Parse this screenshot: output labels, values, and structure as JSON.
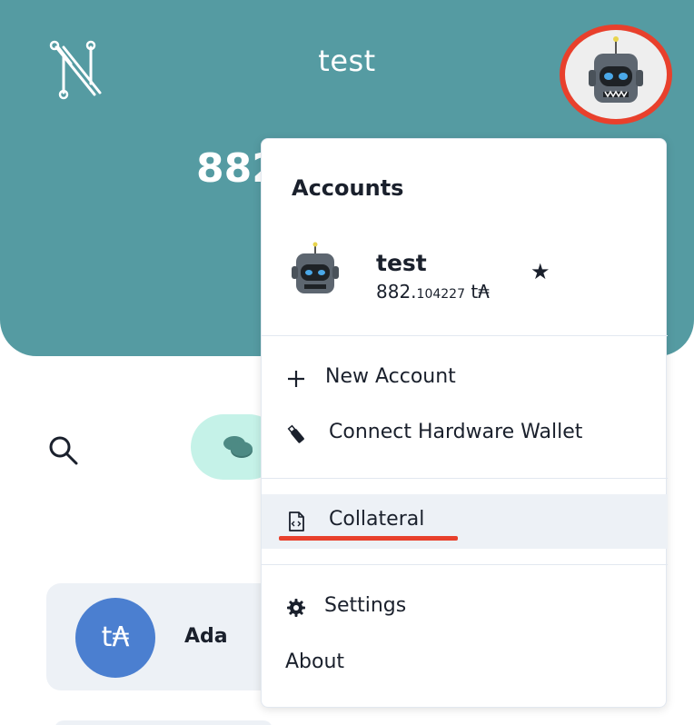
{
  "header": {
    "account_name": "test",
    "balance_visible": "882",
    "logo_icon": "nami-logo-icon",
    "avatar_icon": "robot-avatar-icon"
  },
  "toolbar": {
    "search_icon": "search-icon",
    "assets_icon": "coins-icon"
  },
  "asset_card": {
    "symbol": "t₳",
    "name": "Ada"
  },
  "menu": {
    "heading": "Accounts",
    "account": {
      "name": "test",
      "balance_int": "882.",
      "balance_dec": "104227",
      "unit": "t₳",
      "star_icon": "star-icon"
    },
    "items": [
      {
        "label": "New Account",
        "icon": "plus-icon"
      },
      {
        "label": "Connect Hardware Wallet",
        "icon": "usb-icon"
      },
      {
        "label": "Collateral",
        "icon": "file-code-icon"
      },
      {
        "label": "Settings",
        "icon": "gear-icon"
      },
      {
        "label": "About",
        "icon": ""
      }
    ]
  },
  "colors": {
    "header_bg": "#559ba2",
    "highlight_ring": "#e8402c",
    "pill_bg": "#c5f2e8",
    "ada_circle": "#4b7fd0",
    "menu_highlight": "#edf1f6"
  }
}
